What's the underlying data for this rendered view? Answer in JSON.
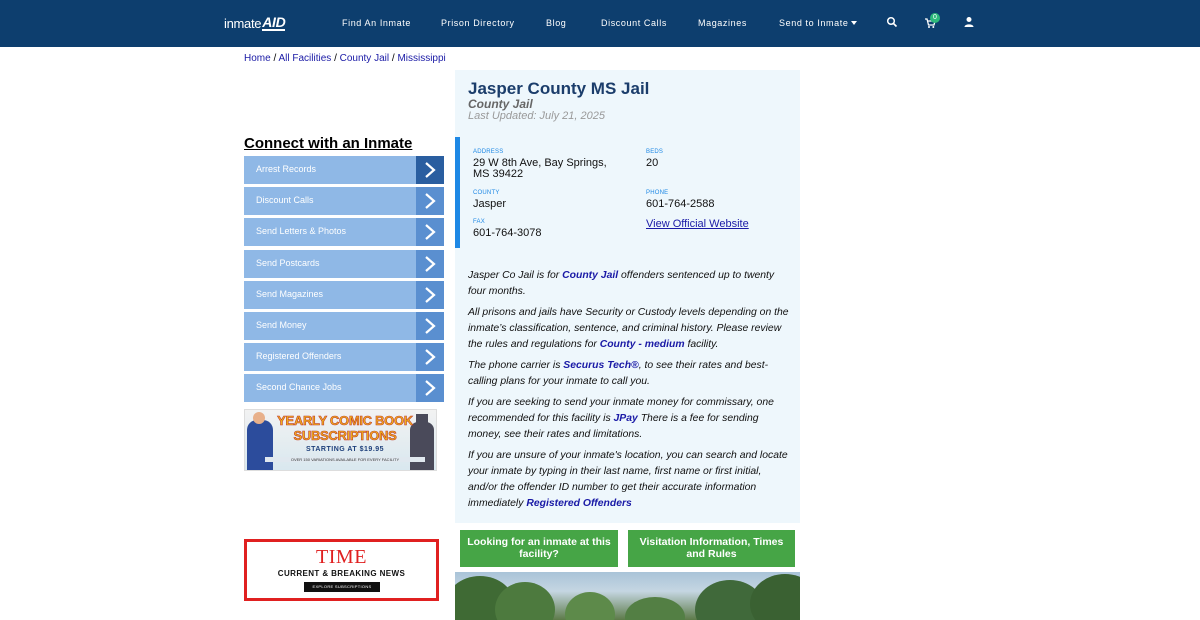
{
  "nav": {
    "logo_part1": "inmate",
    "logo_part2": "AID",
    "items": [
      {
        "label": "Find An Inmate"
      },
      {
        "label": "Prison Directory"
      },
      {
        "label": "Blog"
      },
      {
        "label": "Discount Calls"
      },
      {
        "label": "Magazines"
      },
      {
        "label": "Send to Inmate"
      }
    ],
    "cart_count": "0",
    "icons": [
      "search-icon",
      "cart-icon",
      "user-icon"
    ]
  },
  "breadcrumb": {
    "home": "Home",
    "all_facilities": "All Facilities",
    "county_jail": "County Jail",
    "state": "Mississippi",
    "separator": "/"
  },
  "sidebar": {
    "title": "Connect with an Inmate",
    "items": [
      {
        "label": "Arrest Records"
      },
      {
        "label": "Discount Calls"
      },
      {
        "label": "Send Letters & Photos"
      },
      {
        "label": "Send Postcards"
      },
      {
        "label": "Send Magazines"
      },
      {
        "label": "Send Money"
      },
      {
        "label": "Registered Offenders"
      },
      {
        "label": "Second Chance Jobs"
      }
    ],
    "comic_ad": {
      "line1": "YEARLY COMIC BOOK",
      "line2": "SUBSCRIPTIONS",
      "line3": "STARTING AT $19.95",
      "line4": "OVER 150 VARIATIONS AVAILABLE FOR EVERY FACILITY"
    },
    "time_ad": {
      "logo": "TIME",
      "tagline": "CURRENT & BREAKING NEWS",
      "button": "EXPLORE SUBSCRIPTIONS"
    }
  },
  "facility": {
    "name": "Jasper County MS Jail",
    "type": "County Jail",
    "updated": "Last Updated: July 21, 2025",
    "address_label": "ADDRESS",
    "address_line1": "29 W 8th Ave, Bay Springs,",
    "address_line2": "MS 39422",
    "beds_label": "BEDS",
    "beds": "20",
    "county_label": "COUNTY",
    "county": "Jasper",
    "phone_label": "PHONE",
    "phone": "601-764-2588",
    "fax_label": "FAX",
    "fax": "601-764-3078",
    "website_link": "View Official Website"
  },
  "description": {
    "p1_a": "Jasper Co Jail is for ",
    "p1_link": "County Jail",
    "p1_b": " offenders sentenced up to twenty four months.",
    "p2_a": "All prisons and jails have Security or Custody levels depending on the inmate’s classification, sentence, and criminal history. Please review the rules and regulations for ",
    "p2_link": "County - medium",
    "p2_b": " facility.",
    "p3_a": "The phone carrier is ",
    "p3_link": "Securus Tech®",
    "p3_b": ", to see their rates and best-calling plans for your inmate to call you.",
    "p4_a": "If you are seeking to send your inmate money for commissary, one recommended for this facility is ",
    "p4_link": "JPay",
    "p4_b": " There is a fee for sending money, see their rates and limitations.",
    "p5_a": "If you are unsure of your inmate's location, you can search and locate your inmate by typing in their last name, first name or first initial, and/or the offender ID number to get their accurate information immediately ",
    "p5_link": "Registered Offenders"
  },
  "buttons": {
    "looking_line1": "Looking for an inmate at this",
    "looking_line2": "facility?",
    "visitation_line1": "Visitation Information, Times",
    "visitation_line2": "and Rules"
  },
  "colors": {
    "nav_bg": "#0d3e6e",
    "menu_bg": "#8fb8e6",
    "panel_bg": "#eef7fc",
    "accent": "#1e88e5",
    "button_green": "#46a546",
    "link": "#1a1aa6"
  }
}
